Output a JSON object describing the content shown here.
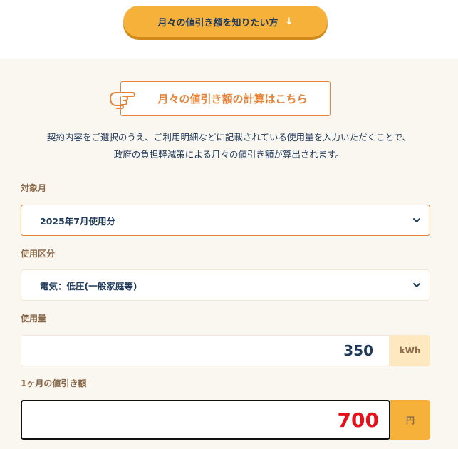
{
  "cta": {
    "label": "月々の値引き額を知りたい方",
    "arrow": "↓"
  },
  "calc_heading": "月々の値引き額の計算はこちら",
  "description": {
    "line1": "契約内容をご選択のうえ、ご利用明細などに記載されている使用量を入力いただくことで、",
    "line2": "政府の負担軽減策による月々の値引き額が算出されます。"
  },
  "fields": {
    "target_month": {
      "label": "対象月",
      "value": "2025年7月使用分"
    },
    "usage_category": {
      "label": "使用区分",
      "value": "電気：低圧(一般家庭等)"
    },
    "usage_amount": {
      "label": "使用量",
      "value": "350",
      "unit": "kWh"
    },
    "monthly_discount": {
      "label": "1ヶ月の値引き額",
      "value": "700",
      "unit": "円"
    }
  },
  "colors": {
    "accent_orange": "#e8843a",
    "button_yellow": "#f6b13a",
    "text_navy": "#1f3a5a",
    "result_red": "#e8101a"
  },
  "icons": {
    "hand": "pointing-hand-icon",
    "chevron": "chevron-down-icon",
    "arrow": "arrow-down-icon"
  }
}
